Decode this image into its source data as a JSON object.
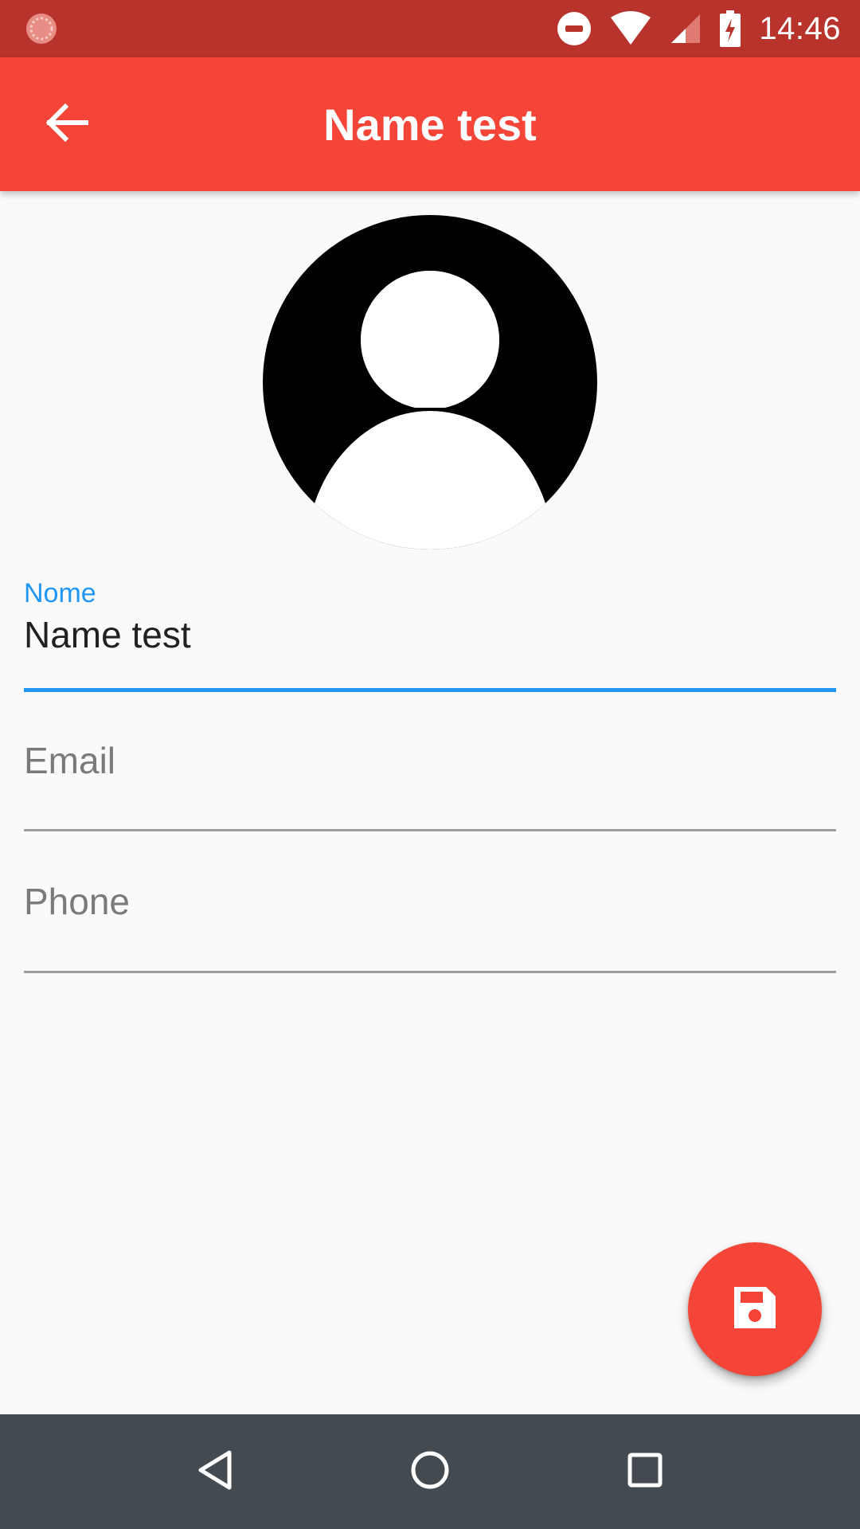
{
  "status_bar": {
    "time": "14:46",
    "icons": [
      "loading-icon",
      "do-not-disturb-icon",
      "wifi-icon",
      "cellular-signal-icon",
      "battery-charging-icon"
    ]
  },
  "app_bar": {
    "title": "Name test",
    "back_icon": "arrow-back-icon",
    "color": "#f44538"
  },
  "avatar": {
    "icon": "person-avatar-icon"
  },
  "form": {
    "name": {
      "label": "Nome",
      "value": "Name test",
      "focused": true
    },
    "email": {
      "placeholder": "Email",
      "value": ""
    },
    "phone": {
      "placeholder": "Phone",
      "value": ""
    }
  },
  "fab": {
    "icon": "save-icon",
    "color": "#f44538"
  },
  "nav_bar": {
    "buttons": [
      "back-triangle-icon",
      "home-circle-icon",
      "recents-square-icon"
    ]
  },
  "colors": {
    "status_bar": "#b8332b",
    "accent": "#2196f3",
    "background": "#fafafa",
    "nav_bar": "#434a50"
  }
}
